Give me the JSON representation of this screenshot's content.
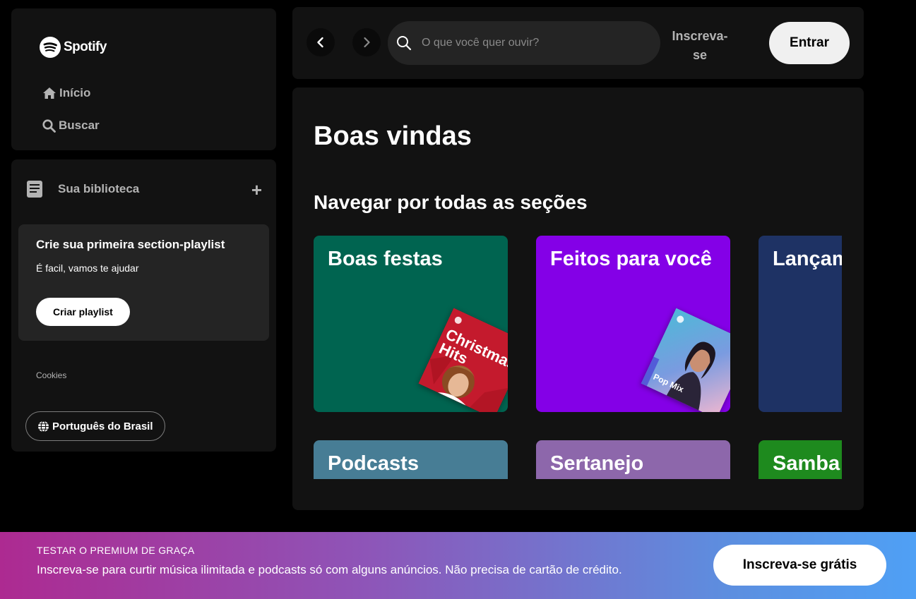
{
  "brand": {
    "name": "Spotify"
  },
  "sidebar": {
    "nav": [
      {
        "label": "Início",
        "icon": "home-icon"
      },
      {
        "label": "Buscar",
        "icon": "search-icon"
      }
    ],
    "library": {
      "title": "Sua biblioteca",
      "add_icon": "plus-icon",
      "create_card": {
        "title": "Crie sua primeira section-playlist",
        "subtitle": "É facil, vamos te ajudar",
        "button": "Criar playlist"
      },
      "cookies_link": "Cookies",
      "language_button": "Português do Brasil"
    }
  },
  "topbar": {
    "search_placeholder": "O que você quer ouvir?",
    "signup_label": "Inscreva-se",
    "login_label": "Entrar"
  },
  "main": {
    "welcome": "Boas vindas",
    "browse_heading": "Navegar por todas as seções",
    "cards": [
      {
        "title": "Boas festas",
        "color": "#006450",
        "cover_text": "Christmas Hits"
      },
      {
        "title": "Feitos para você",
        "color": "#8400e7",
        "cover_text": "Pop Mix"
      },
      {
        "title": "Lançamentos",
        "color": "#1e3264"
      },
      {
        "title": "Podcasts",
        "color": "#477d95"
      },
      {
        "title": "Sertanejo",
        "color": "#8d67ab"
      },
      {
        "title": "Samba",
        "color": "#1e8a1e"
      }
    ]
  },
  "banner": {
    "title": "TESTAR O PREMIUM DE GRAÇA",
    "text": "Inscreva-se para curtir música ilimitada e podcasts só com alguns anúncios. Não precisa de cartão de crédito.",
    "button": "Inscreva-se grátis"
  }
}
